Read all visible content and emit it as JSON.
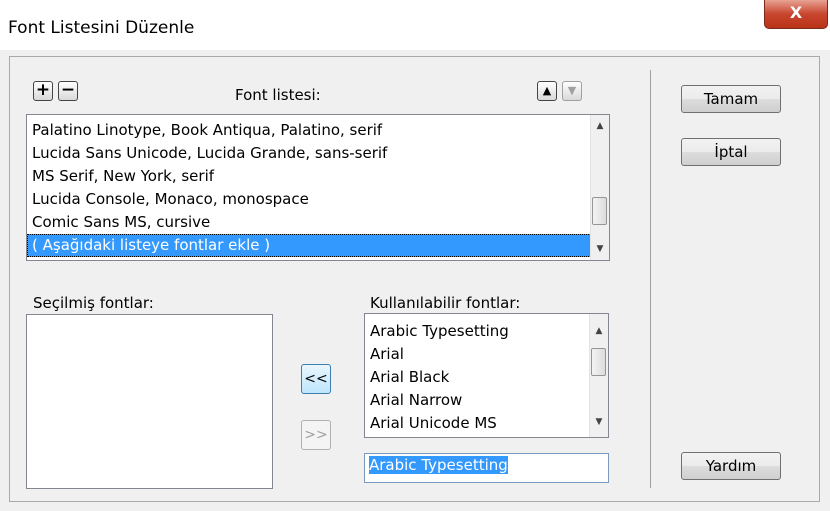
{
  "window": {
    "title": "Font Listesini Düzenle",
    "close_glyph": "X"
  },
  "font_list": {
    "label": "Font listesi:",
    "add_glyph": "+",
    "remove_glyph": "−",
    "up_glyph": "▲",
    "down_glyph": "▼",
    "items": [
      "Palatino Linotype, Book Antiqua, Palatino, serif",
      "Lucida Sans Unicode, Lucida Grande, sans-serif",
      "MS Serif, New York, serif",
      "Lucida Console, Monaco, monospace",
      "Comic Sans MS, cursive",
      "( Aşağıdaki listeye fontlar ekle )"
    ],
    "selected_index": 5
  },
  "selected_fonts": {
    "label": "Seçilmiş fontlar:",
    "items": []
  },
  "available_fonts": {
    "label": "Kullanılabilir fontlar:",
    "items": [
      "Arabic Typesetting",
      "Arial",
      "Arial Black",
      "Arial Narrow",
      "Arial Unicode MS"
    ],
    "input_value": "Arabic Typesetting"
  },
  "move_buttons": {
    "add_label": "<<",
    "remove_label": ">>"
  },
  "buttons": {
    "ok": "Tamam",
    "cancel": "İptal",
    "help": "Yardım"
  }
}
